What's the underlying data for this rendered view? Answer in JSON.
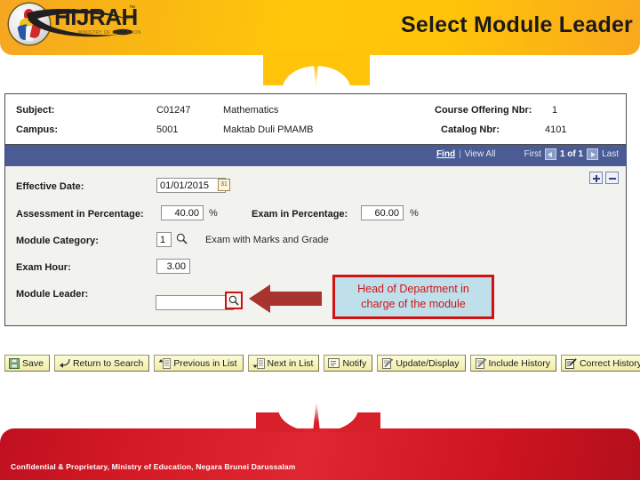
{
  "header": {
    "title": "Select Module Leader",
    "logo": {
      "wordmark": "HIJRAH",
      "tm": "™",
      "tagline": "MINISTRY OF EDUCATION"
    }
  },
  "info": {
    "rows": [
      {
        "label": "Subject:",
        "code": "C01247",
        "name": "Mathematics"
      },
      {
        "label": "Campus:",
        "code": "5001",
        "name": "Maktab Duli PMAMB"
      }
    ],
    "right": [
      {
        "label": "Course Offering Nbr:",
        "value": "1"
      },
      {
        "label": "Catalog Nbr:",
        "value": "4101"
      }
    ]
  },
  "navbar": {
    "find": "Find",
    "separator": "|",
    "view_all": "View All",
    "first": "First",
    "counter": "1 of 1",
    "last": "Last",
    "prev_icon": "left-triangle-icon",
    "next_icon": "right-triangle-icon"
  },
  "form": {
    "effective_date": {
      "label": "Effective Date:",
      "value": "01/01/2015",
      "calendar_icon": "calendar-icon",
      "calendar_glyph": "31"
    },
    "assessment": {
      "label": "Assessment in Percentage:",
      "value": "40.00",
      "suffix": "%"
    },
    "exam_percentage": {
      "label": "Exam in Percentage:",
      "value": "60.00",
      "suffix": "%"
    },
    "module_category": {
      "label": "Module Category:",
      "value": "1",
      "lookup_icon": "magnifier-icon",
      "description": "Exam with Marks and Grade"
    },
    "exam_hour": {
      "label": "Exam Hour:",
      "value": "3.00"
    },
    "module_leader": {
      "label": "Module Leader:",
      "value": "",
      "placeholder": "",
      "lookup_icon": "magnifier-icon"
    },
    "row_buttons": {
      "add_icon": "plus-icon",
      "delete_icon": "minus-icon"
    }
  },
  "annotation": {
    "arrow_icon": "left-arrow-icon",
    "arrow_color": "#a8332f",
    "callout_line1": "Head of Department in",
    "callout_line2": "charge of the module",
    "callout_bg": "#bfdfeb",
    "callout_border": "#d21212",
    "callout_text_color": "#d01515"
  },
  "toolbar": {
    "buttons": [
      {
        "label": "Save",
        "icon": "floppy-disk-icon"
      },
      {
        "label": "Return to Search",
        "icon": "return-arrow-icon"
      },
      {
        "label": "Previous in List",
        "icon": "up-list-icon"
      },
      {
        "label": "Next in List",
        "icon": "down-list-icon"
      },
      {
        "label": "Notify",
        "icon": "envelope-icon"
      },
      {
        "label": "Update/Display",
        "icon": "pencil-page-icon"
      },
      {
        "label": "Include History",
        "icon": "pencil-page-icon"
      },
      {
        "label": "Correct History",
        "icon": "pencil-edit-icon"
      }
    ]
  },
  "footer": {
    "text": "Confidential & Proprietary, Ministry of Education, Negara Brunei Darussalam"
  },
  "colors": {
    "header_yellow": "#ffc409",
    "footer_red": "#d8202b",
    "navbar_blue": "#4a5c93",
    "form_bg": "#f2f2ee"
  }
}
